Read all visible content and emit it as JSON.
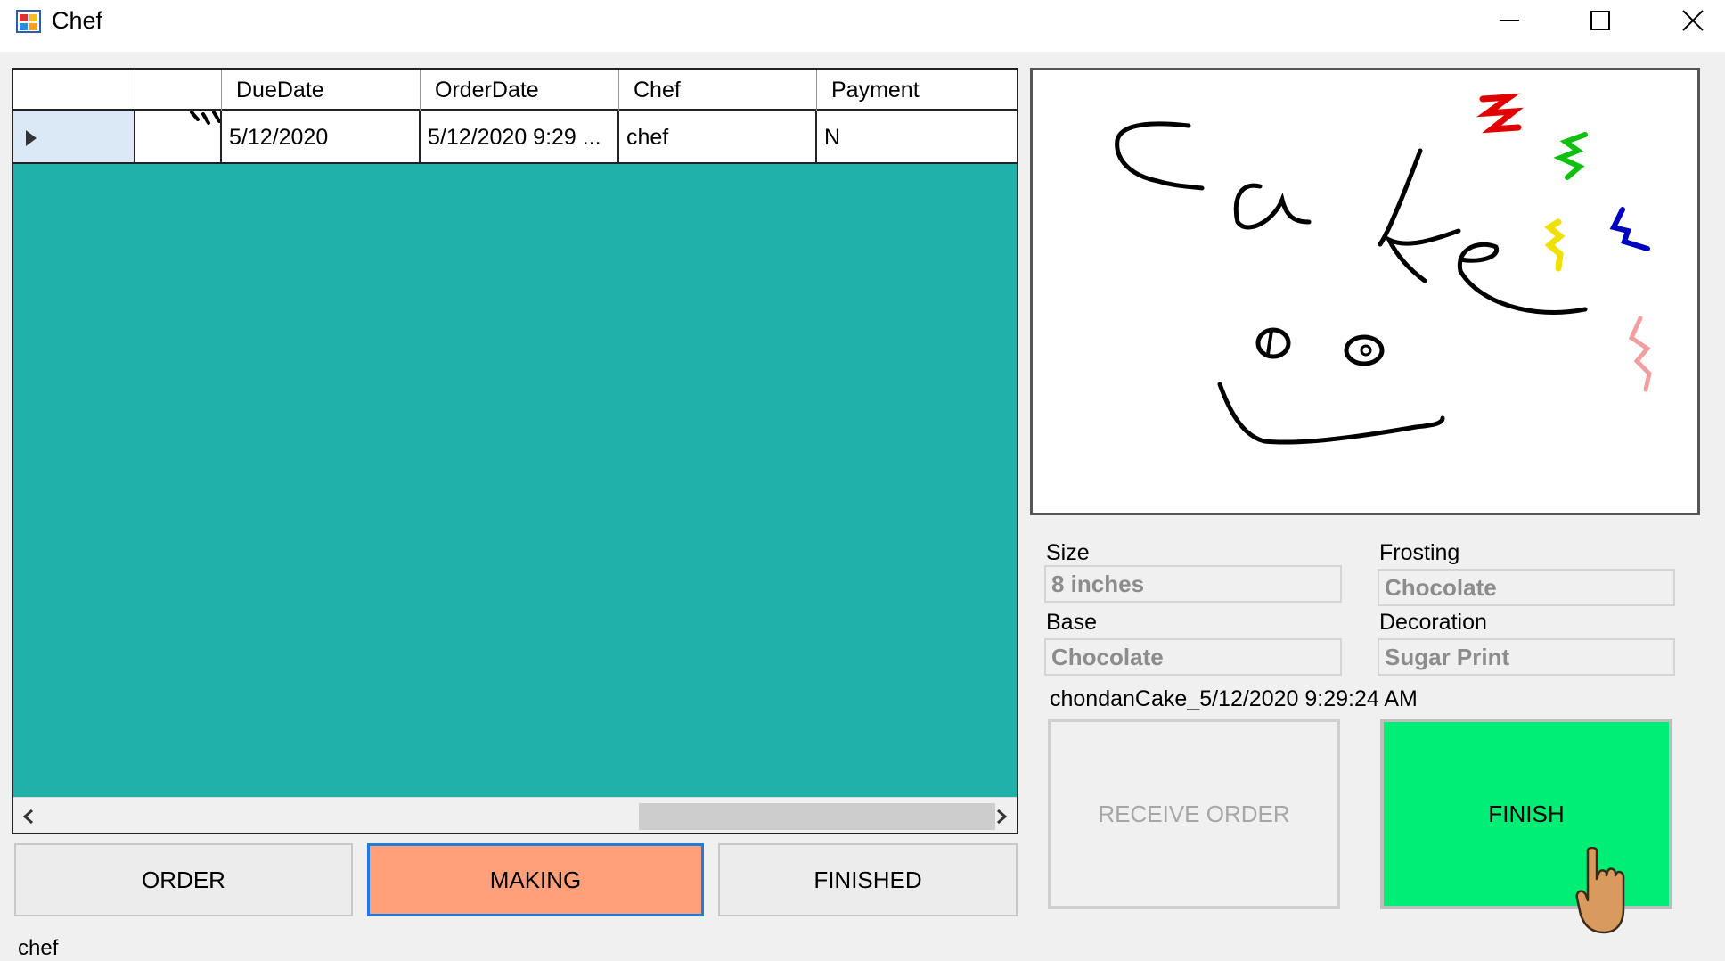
{
  "window": {
    "title": "Chef"
  },
  "grid": {
    "columns": [
      "",
      "",
      "DueDate",
      "OrderDate",
      "Chef",
      "Payment"
    ],
    "rows": [
      {
        "due_date": "5/12/2020",
        "order_date": "5/12/2020 9:29 ...",
        "chef": "chef",
        "payment": "N"
      }
    ],
    "background_color": "#20b2aa"
  },
  "tabs": {
    "order": "ORDER",
    "making": "MAKING",
    "finished": "FINISHED",
    "active": "MAKING",
    "active_color": "#ffa07a"
  },
  "status": {
    "user": "chef"
  },
  "details": {
    "size_label": "Size",
    "size_value": "8 inches",
    "frosting_label": "Frosting",
    "frosting_value": "Chocolate",
    "base_label": "Base",
    "base_value": "Chocolate",
    "decoration_label": "Decoration",
    "decoration_value": "Sugar Print",
    "order_id": "chondanCake_5/12/2020 9:29:24 AM"
  },
  "actions": {
    "receive": "RECEIVE ORDER",
    "finish": "FINISH",
    "finish_color": "#00ee76"
  },
  "picture": {
    "drawing_text": "Cake"
  },
  "icons": [
    "app-icon",
    "minimize-icon",
    "maximize-icon",
    "close-icon",
    "row-selector-icon",
    "scroll-left-icon",
    "scroll-right-icon",
    "hand-cursor-icon"
  ]
}
